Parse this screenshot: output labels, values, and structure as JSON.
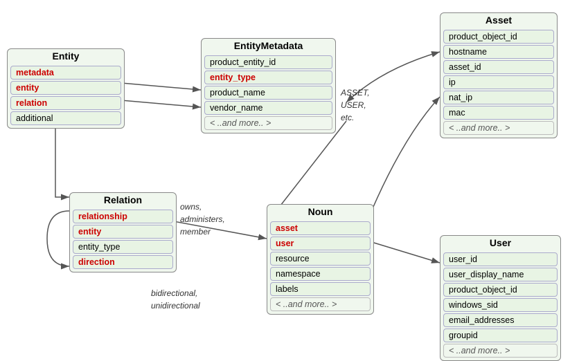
{
  "entity": {
    "title": "Entity",
    "fields": [
      {
        "label": "metadata",
        "style": "bold"
      },
      {
        "label": "entity",
        "style": "bold"
      },
      {
        "label": "relation",
        "style": "bold"
      },
      {
        "label": "additional",
        "style": "plain"
      }
    ]
  },
  "entityMetadata": {
    "title": "EntityMetadata",
    "fields": [
      {
        "label": "product_entity_id",
        "style": "plain"
      },
      {
        "label": "entity_type",
        "style": "bold"
      },
      {
        "label": "product_name",
        "style": "plain"
      },
      {
        "label": "vendor_name",
        "style": "plain"
      },
      {
        "label": "< ..and more.. >",
        "style": "italic"
      }
    ],
    "annotation": "ASSET,\nUSER,\netc."
  },
  "asset": {
    "title": "Asset",
    "fields": [
      {
        "label": "product_object_id",
        "style": "plain"
      },
      {
        "label": "hostname",
        "style": "plain"
      },
      {
        "label": "asset_id",
        "style": "plain"
      },
      {
        "label": "ip",
        "style": "plain"
      },
      {
        "label": "nat_ip",
        "style": "plain"
      },
      {
        "label": "mac",
        "style": "plain"
      },
      {
        "label": "< ..and more.. >",
        "style": "italic"
      }
    ]
  },
  "relation": {
    "title": "Relation",
    "fields": [
      {
        "label": "relationship",
        "style": "bold"
      },
      {
        "label": "entity",
        "style": "bold"
      },
      {
        "label": "entity_type",
        "style": "plain"
      },
      {
        "label": "direction",
        "style": "bold"
      }
    ],
    "annotation1": "owns,\nadministers,\nmember",
    "annotation2": "bidirectional,\nunidirectional"
  },
  "noun": {
    "title": "Noun",
    "fields": [
      {
        "label": "asset",
        "style": "bold"
      },
      {
        "label": "user",
        "style": "bold"
      },
      {
        "label": "resource",
        "style": "plain"
      },
      {
        "label": "namespace",
        "style": "plain"
      },
      {
        "label": "labels",
        "style": "plain"
      },
      {
        "label": "< ..and more.. >",
        "style": "italic"
      }
    ]
  },
  "user": {
    "title": "User",
    "fields": [
      {
        "label": "user_id",
        "style": "plain"
      },
      {
        "label": "user_display_name",
        "style": "plain"
      },
      {
        "label": "product_object_id",
        "style": "plain"
      },
      {
        "label": "windows_sid",
        "style": "plain"
      },
      {
        "label": "email_addresses",
        "style": "plain"
      },
      {
        "label": "groupid",
        "style": "plain"
      },
      {
        "label": "< ..and more.. >",
        "style": "italic"
      }
    ]
  }
}
